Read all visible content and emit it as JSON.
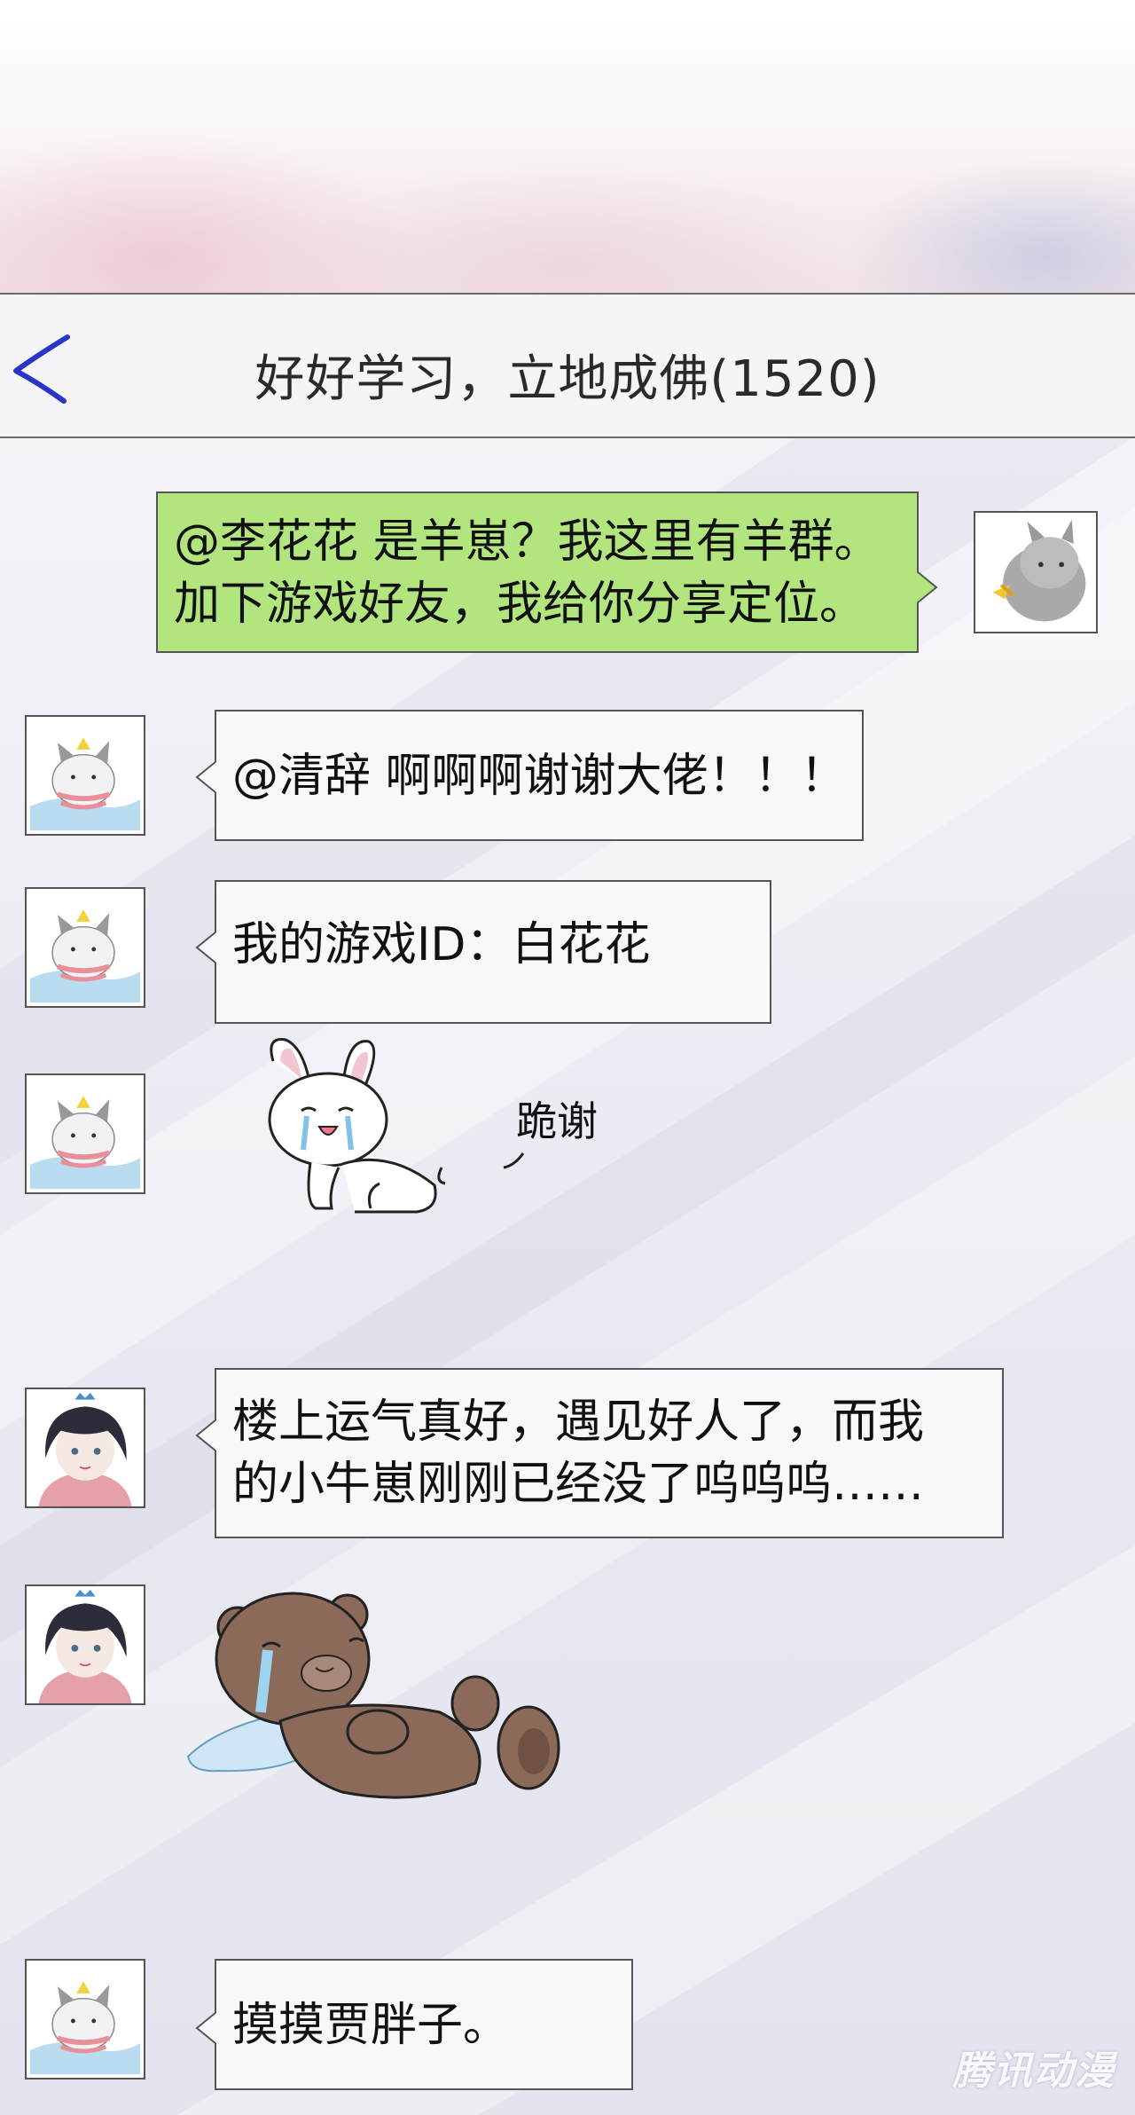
{
  "chat": {
    "title": "好好学习，立地成佛(1520)"
  },
  "messages": [
    {
      "sender": "self",
      "lines": [
        "@李花花 是羊崽？我这里有羊群。",
        "加下游戏好友，我给你分享定位。"
      ]
    },
    {
      "sender": "white-cat",
      "lines": [
        "@清辞 啊啊啊谢谢大佬！！！"
      ]
    },
    {
      "sender": "white-cat",
      "lines": [
        "我的游戏ID：白花花"
      ]
    },
    {
      "sender": "white-cat",
      "sticker": "crying-bunny-sticker",
      "sticker_text": "跪谢"
    },
    {
      "sender": "girl",
      "lines": [
        "楼上运气真好，遇见好人了，而我",
        "的小牛崽刚刚已经没了呜呜呜……"
      ]
    },
    {
      "sender": "girl",
      "sticker": "crying-bear-sticker"
    },
    {
      "sender": "white-cat",
      "lines": [
        "摸摸贾胖子。"
      ]
    }
  ],
  "watermark": "腾讯动漫",
  "icons": {
    "back": "chevron-left-icon"
  },
  "colors": {
    "self_bubble": "#b2e57e",
    "other_bubble": "#f8f8fb",
    "back_icon": "#2b34c9"
  }
}
